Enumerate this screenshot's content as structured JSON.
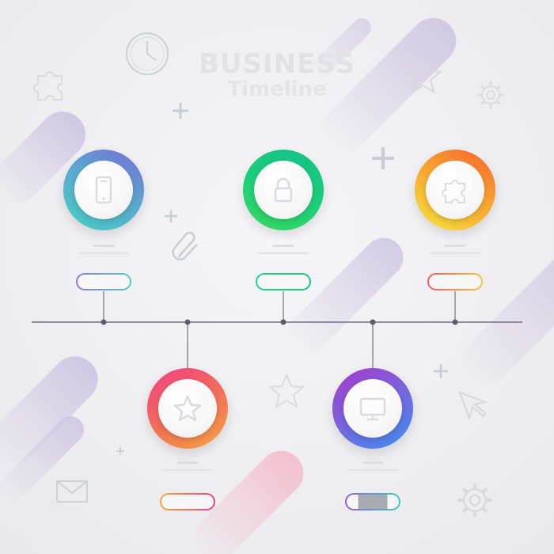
{
  "title": {
    "line1": "BUSINESS",
    "line2": "Timeline"
  },
  "colors": {
    "timeline": "#6f7283",
    "stripe": "#d7cde4",
    "deco": "#cfd5dd"
  },
  "milestones": [
    {
      "id": "m1",
      "icon": "smartphone-icon",
      "position": "top",
      "ring": [
        "#49d1c2",
        "#7b6bd6"
      ]
    },
    {
      "id": "m2",
      "icon": "lock-icon",
      "position": "top",
      "ring": [
        "#1fd277",
        "#12c08a"
      ]
    },
    {
      "id": "m3",
      "icon": "puzzle-icon",
      "position": "top",
      "ring": [
        "#f5e53c",
        "#f7602b"
      ]
    },
    {
      "id": "m4",
      "icon": "star-icon",
      "position": "bottom",
      "ring": [
        "#f5a640",
        "#ef3f86"
      ]
    },
    {
      "id": "m5",
      "icon": "monitor-icon",
      "position": "bottom",
      "ring": [
        "#3f8ff0",
        "#a738c9"
      ]
    }
  ],
  "decorations": [
    "clock-icon",
    "puzzle-outline-icon",
    "star-outline-icon",
    "gear-icon",
    "plus-icon",
    "paperclip-icon",
    "envelope-icon",
    "cursor-icon"
  ]
}
